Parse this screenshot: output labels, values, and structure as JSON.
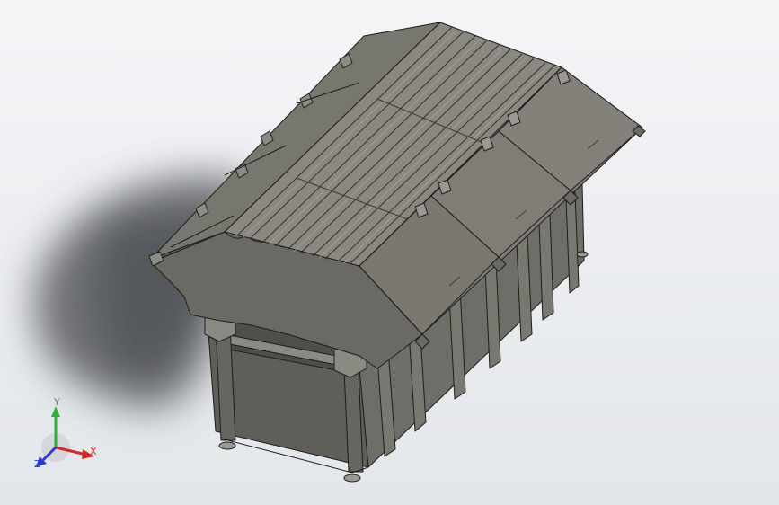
{
  "viewport": {
    "background_top": "#f4f5f7",
    "background_bottom": "#e3e6ea",
    "shadow_color": "#6f7276"
  },
  "model": {
    "body_color": "#6b6a64",
    "lid_color": "#7f7d76",
    "edge_color": "#1d1d1b",
    "inner_color": "#58574f"
  },
  "triad": {
    "x_label": "X",
    "y_label": "Y",
    "z_label": "Z",
    "x_color": "#d12a2a",
    "y_color": "#2fae3a",
    "z_color": "#2a3fd1"
  }
}
